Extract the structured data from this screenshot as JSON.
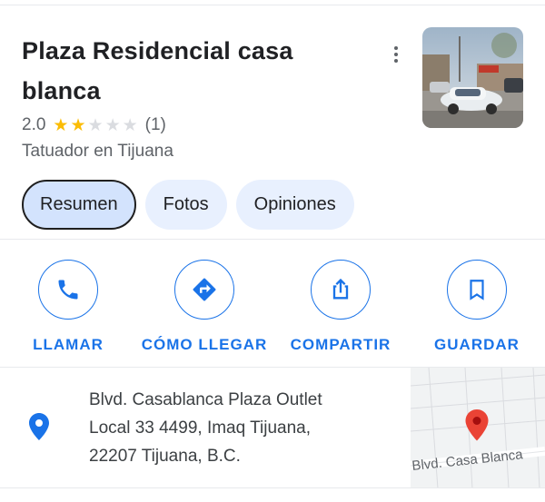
{
  "place": {
    "title": "Plaza Residencial casa blanca",
    "rating_value": "2.0",
    "rating": 2,
    "rating_max": 5,
    "review_count": "(1)",
    "category": "Tatuador en Tijuana",
    "thumbnail_icon": "place-photo-thumbnail"
  },
  "tabs": [
    {
      "label": "Resumen",
      "active": true
    },
    {
      "label": "Fotos",
      "active": false
    },
    {
      "label": "Opiniones",
      "active": false
    }
  ],
  "actions": [
    {
      "label": "LLAMAR",
      "icon": "phone-icon"
    },
    {
      "label": "CÓMO LLEGAR",
      "icon": "directions-icon"
    },
    {
      "label": "COMPARTIR",
      "icon": "share-icon"
    },
    {
      "label": "GUARDAR",
      "icon": "bookmark-icon"
    }
  ],
  "address": {
    "lines": [
      "Blvd. Casablanca Plaza Outlet",
      "Local 33 4499, Imaq Tijuana,",
      "22207 Tijuana, B.C."
    ],
    "icon": "location-pin-icon"
  },
  "map": {
    "street_label": "Blvd. Casa Blanca",
    "marker_icon": "map-marker-icon"
  },
  "colors": {
    "accent": "#1a73e8",
    "star": "#fbbc04",
    "tab_bg": "#e8f0fe",
    "tab_active_bg": "#d3e3fd",
    "marker": "#ea4335"
  }
}
